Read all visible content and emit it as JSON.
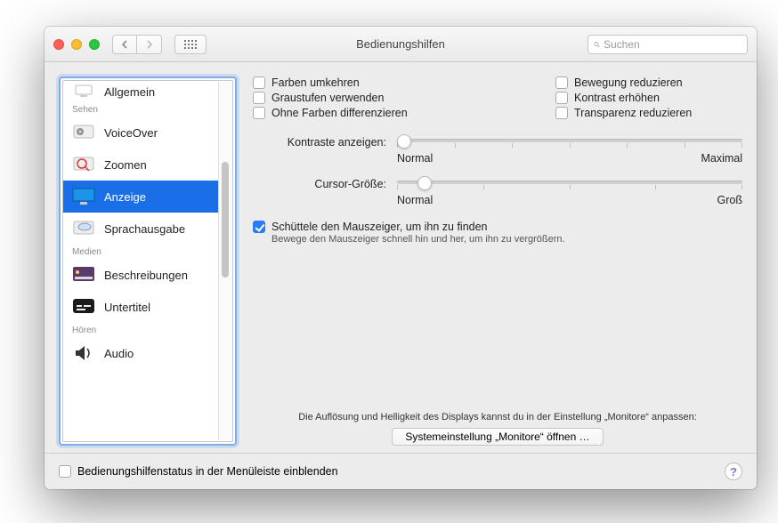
{
  "titlebar": {
    "title": "Bedienungshilfen",
    "search_placeholder": "Suchen"
  },
  "sidebar": {
    "groups": [
      {
        "label": "",
        "items": [
          {
            "id": "allgemein",
            "label": "Allgemein",
            "truncated": true
          }
        ]
      },
      {
        "label": "Sehen",
        "items": [
          {
            "id": "voiceover",
            "label": "VoiceOver"
          },
          {
            "id": "zoomen",
            "label": "Zoomen"
          },
          {
            "id": "anzeige",
            "label": "Anzeige",
            "selected": true
          },
          {
            "id": "sprachausgabe",
            "label": "Sprachausgabe"
          }
        ]
      },
      {
        "label": "Medien",
        "items": [
          {
            "id": "beschreibungen",
            "label": "Beschreibungen"
          },
          {
            "id": "untertitel",
            "label": "Untertitel"
          }
        ]
      },
      {
        "label": "Hören",
        "items": [
          {
            "id": "audio",
            "label": "Audio"
          }
        ]
      }
    ]
  },
  "pane": {
    "checks_left": [
      {
        "id": "invert",
        "label": "Farben umkehren",
        "checked": false
      },
      {
        "id": "grayscale",
        "label": "Graustufen verwenden",
        "checked": false
      },
      {
        "id": "diff",
        "label": "Ohne Farben differenzieren",
        "checked": false
      }
    ],
    "checks_right": [
      {
        "id": "motion",
        "label": "Bewegung reduzieren",
        "checked": false
      },
      {
        "id": "contrast",
        "label": "Kontrast erhöhen",
        "checked": false
      },
      {
        "id": "transparency",
        "label": "Transparenz reduzieren",
        "checked": false
      }
    ],
    "sliders": {
      "contrast": {
        "label": "Kontraste anzeigen:",
        "min_label": "Normal",
        "max_label": "Maximal",
        "value_percent": 0
      },
      "cursor": {
        "label": "Cursor-Größe:",
        "min_label": "Normal",
        "max_label": "Groß",
        "value_percent": 8
      }
    },
    "shake": {
      "label": "Schüttele den Mauszeiger, um ihn zu finden",
      "sub": "Bewege den Mauszeiger schnell hin und her, um ihn zu vergrößern.",
      "checked": true
    },
    "hint": "Die Auflösung und Helligkeit des Displays kannst du in der Einstellung „Monitore“ anpassen:",
    "open_button": "Systemeinstellung „Monitore“ öffnen …"
  },
  "footer": {
    "status_checkbox": "Bedienungshilfenstatus in der Menüleiste einblenden",
    "checked": false
  }
}
